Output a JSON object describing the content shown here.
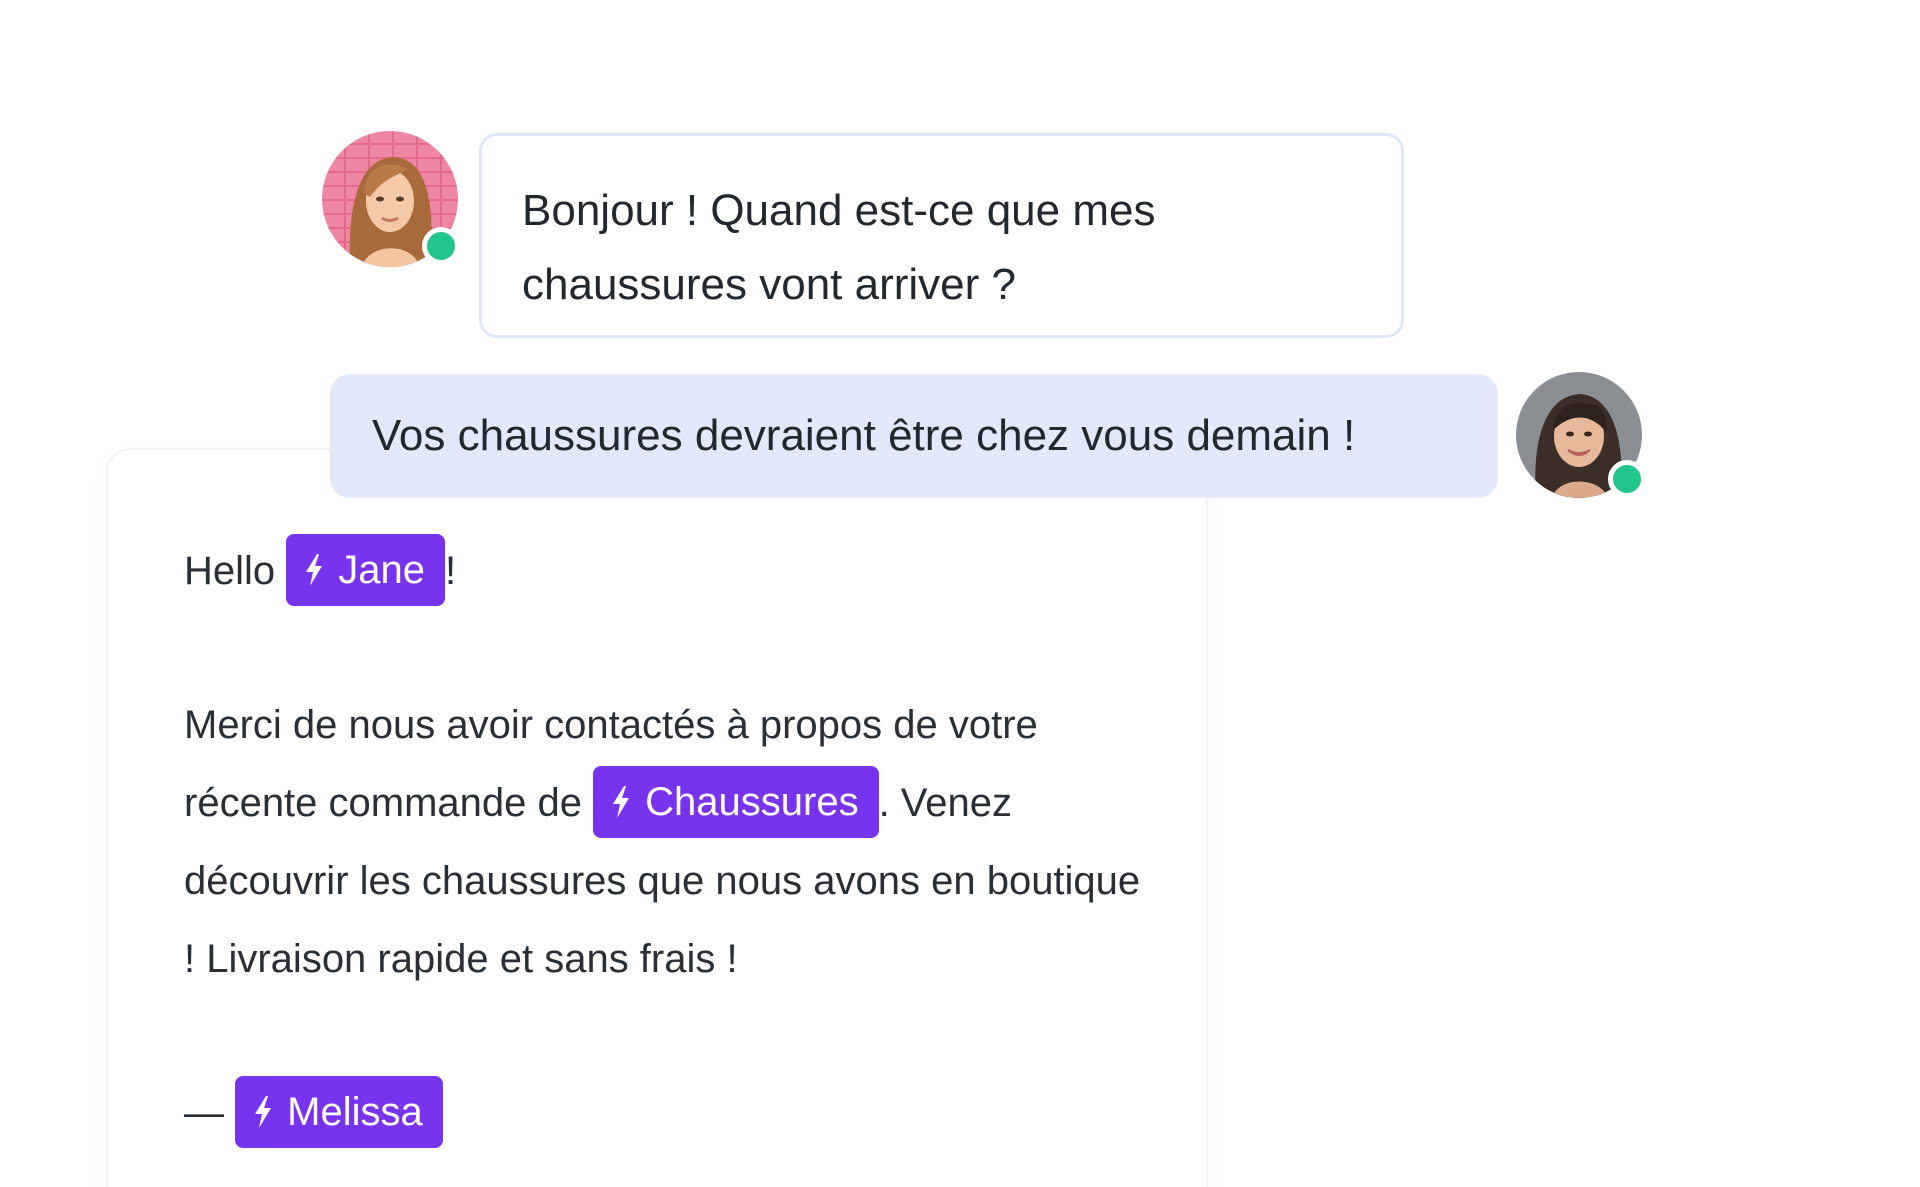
{
  "conversation": {
    "customer": {
      "avatar_icon": "woman-avatar-icon",
      "status": "online",
      "message": "Bonjour ! Quand est-ce que mes chaussures vont arriver ?"
    },
    "agent": {
      "avatar_icon": "woman-avatar-icon",
      "status": "online",
      "message": "Vos chaussures devraient être chez vous demain !"
    }
  },
  "template": {
    "greeting_prefix": "Hello",
    "greeting_tag": "Jane",
    "greeting_suffix": "!",
    "body_prefix": "Merci de nous avoir contactés à propos de votre récente commande de",
    "body_tag": "Chaussures",
    "body_suffix": ". Venez découvrir les chaussures que nous avons en boutique ! Livraison rapide et sans frais !",
    "signature_prefix": "—",
    "signature_tag": "Melissa"
  },
  "colors": {
    "tag_background": "#7733ee",
    "agent_bubble": "#e3e8fb",
    "customer_bubble_border": "#dfe5fb",
    "online_status": "#22c58b"
  }
}
